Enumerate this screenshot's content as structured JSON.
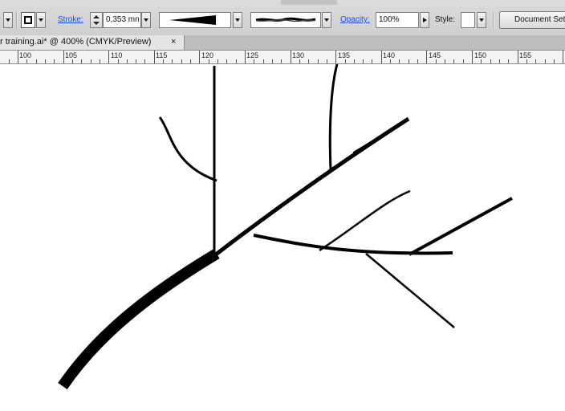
{
  "control_bar": {
    "stroke_label": "Stroke:",
    "stroke_weight_value": "0,353 mn",
    "opacity_label": "Opacity:",
    "opacity_value": "100%",
    "style_label": "Style:",
    "document_setup_label": "Document Setup",
    "icons": [
      "chevron-down-icon",
      "stroke-swatch-icon",
      "spinner-icon",
      "variable-width-profile-icon",
      "brush-definition-icon",
      "chevron-right-icon"
    ]
  },
  "tab": {
    "title": "r training.ai* @ 400% (CMYK/Preview)",
    "close_glyph": "×"
  },
  "ruler": {
    "labels": [
      "100",
      "105",
      "110",
      "115",
      "120",
      "125",
      "130",
      "135",
      "140",
      "145",
      "150",
      "155"
    ]
  },
  "colors": {
    "link_blue": "#1a4fd6",
    "stroke": "#000000"
  }
}
